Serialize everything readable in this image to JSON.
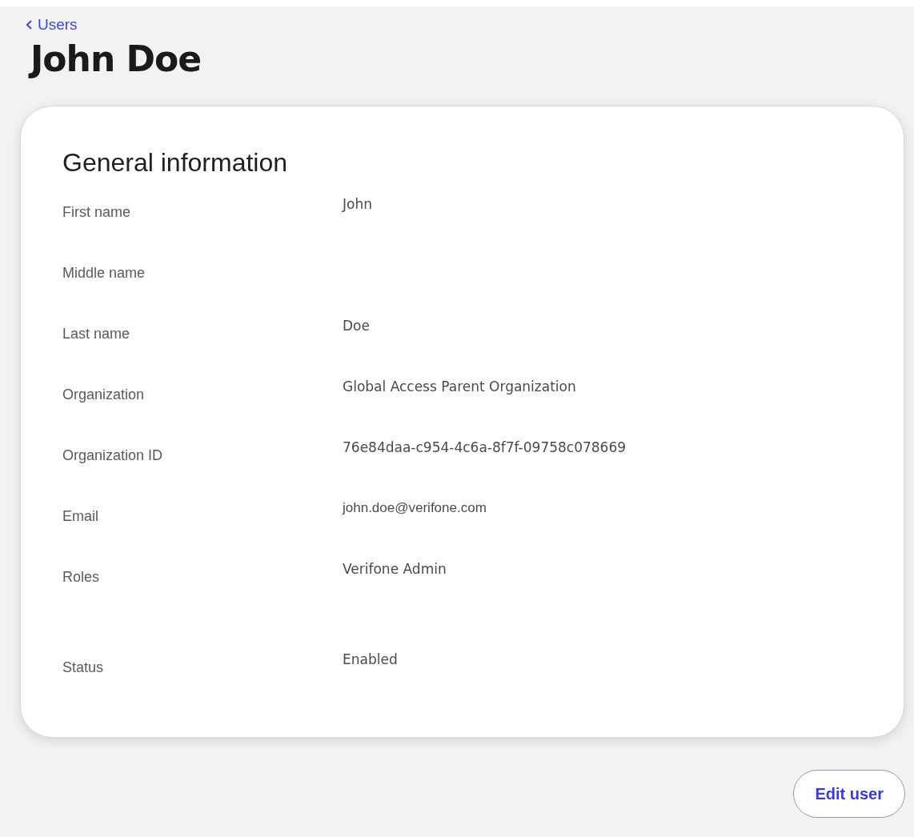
{
  "breadcrumb": {
    "label": "Users"
  },
  "title": "John Doe",
  "card": {
    "title": "General information",
    "rows": [
      {
        "label": "First name",
        "kind": "text",
        "value": "John"
      },
      {
        "label": "Middle name",
        "kind": "text"
      },
      {
        "label": "Last name",
        "kind": "text",
        "value": "Doe"
      },
      {
        "label": "Organization",
        "kind": "text",
        "value": "Global Access Parent Organization"
      },
      {
        "label": "Organization ID",
        "kind": "text",
        "value": "76e84daa-c954-4c6a-8f7f-09758c078669"
      },
      {
        "label": "Email",
        "kind": "email",
        "value": "john.doe@verifone.com"
      },
      {
        "label": "Roles",
        "kind": "list",
        "values": [
          "Verifone Admin"
        ]
      },
      {
        "label": "Status",
        "kind": "text",
        "value": "Enabled"
      }
    ]
  },
  "buttons": [
    "Edit user"
  ]
}
